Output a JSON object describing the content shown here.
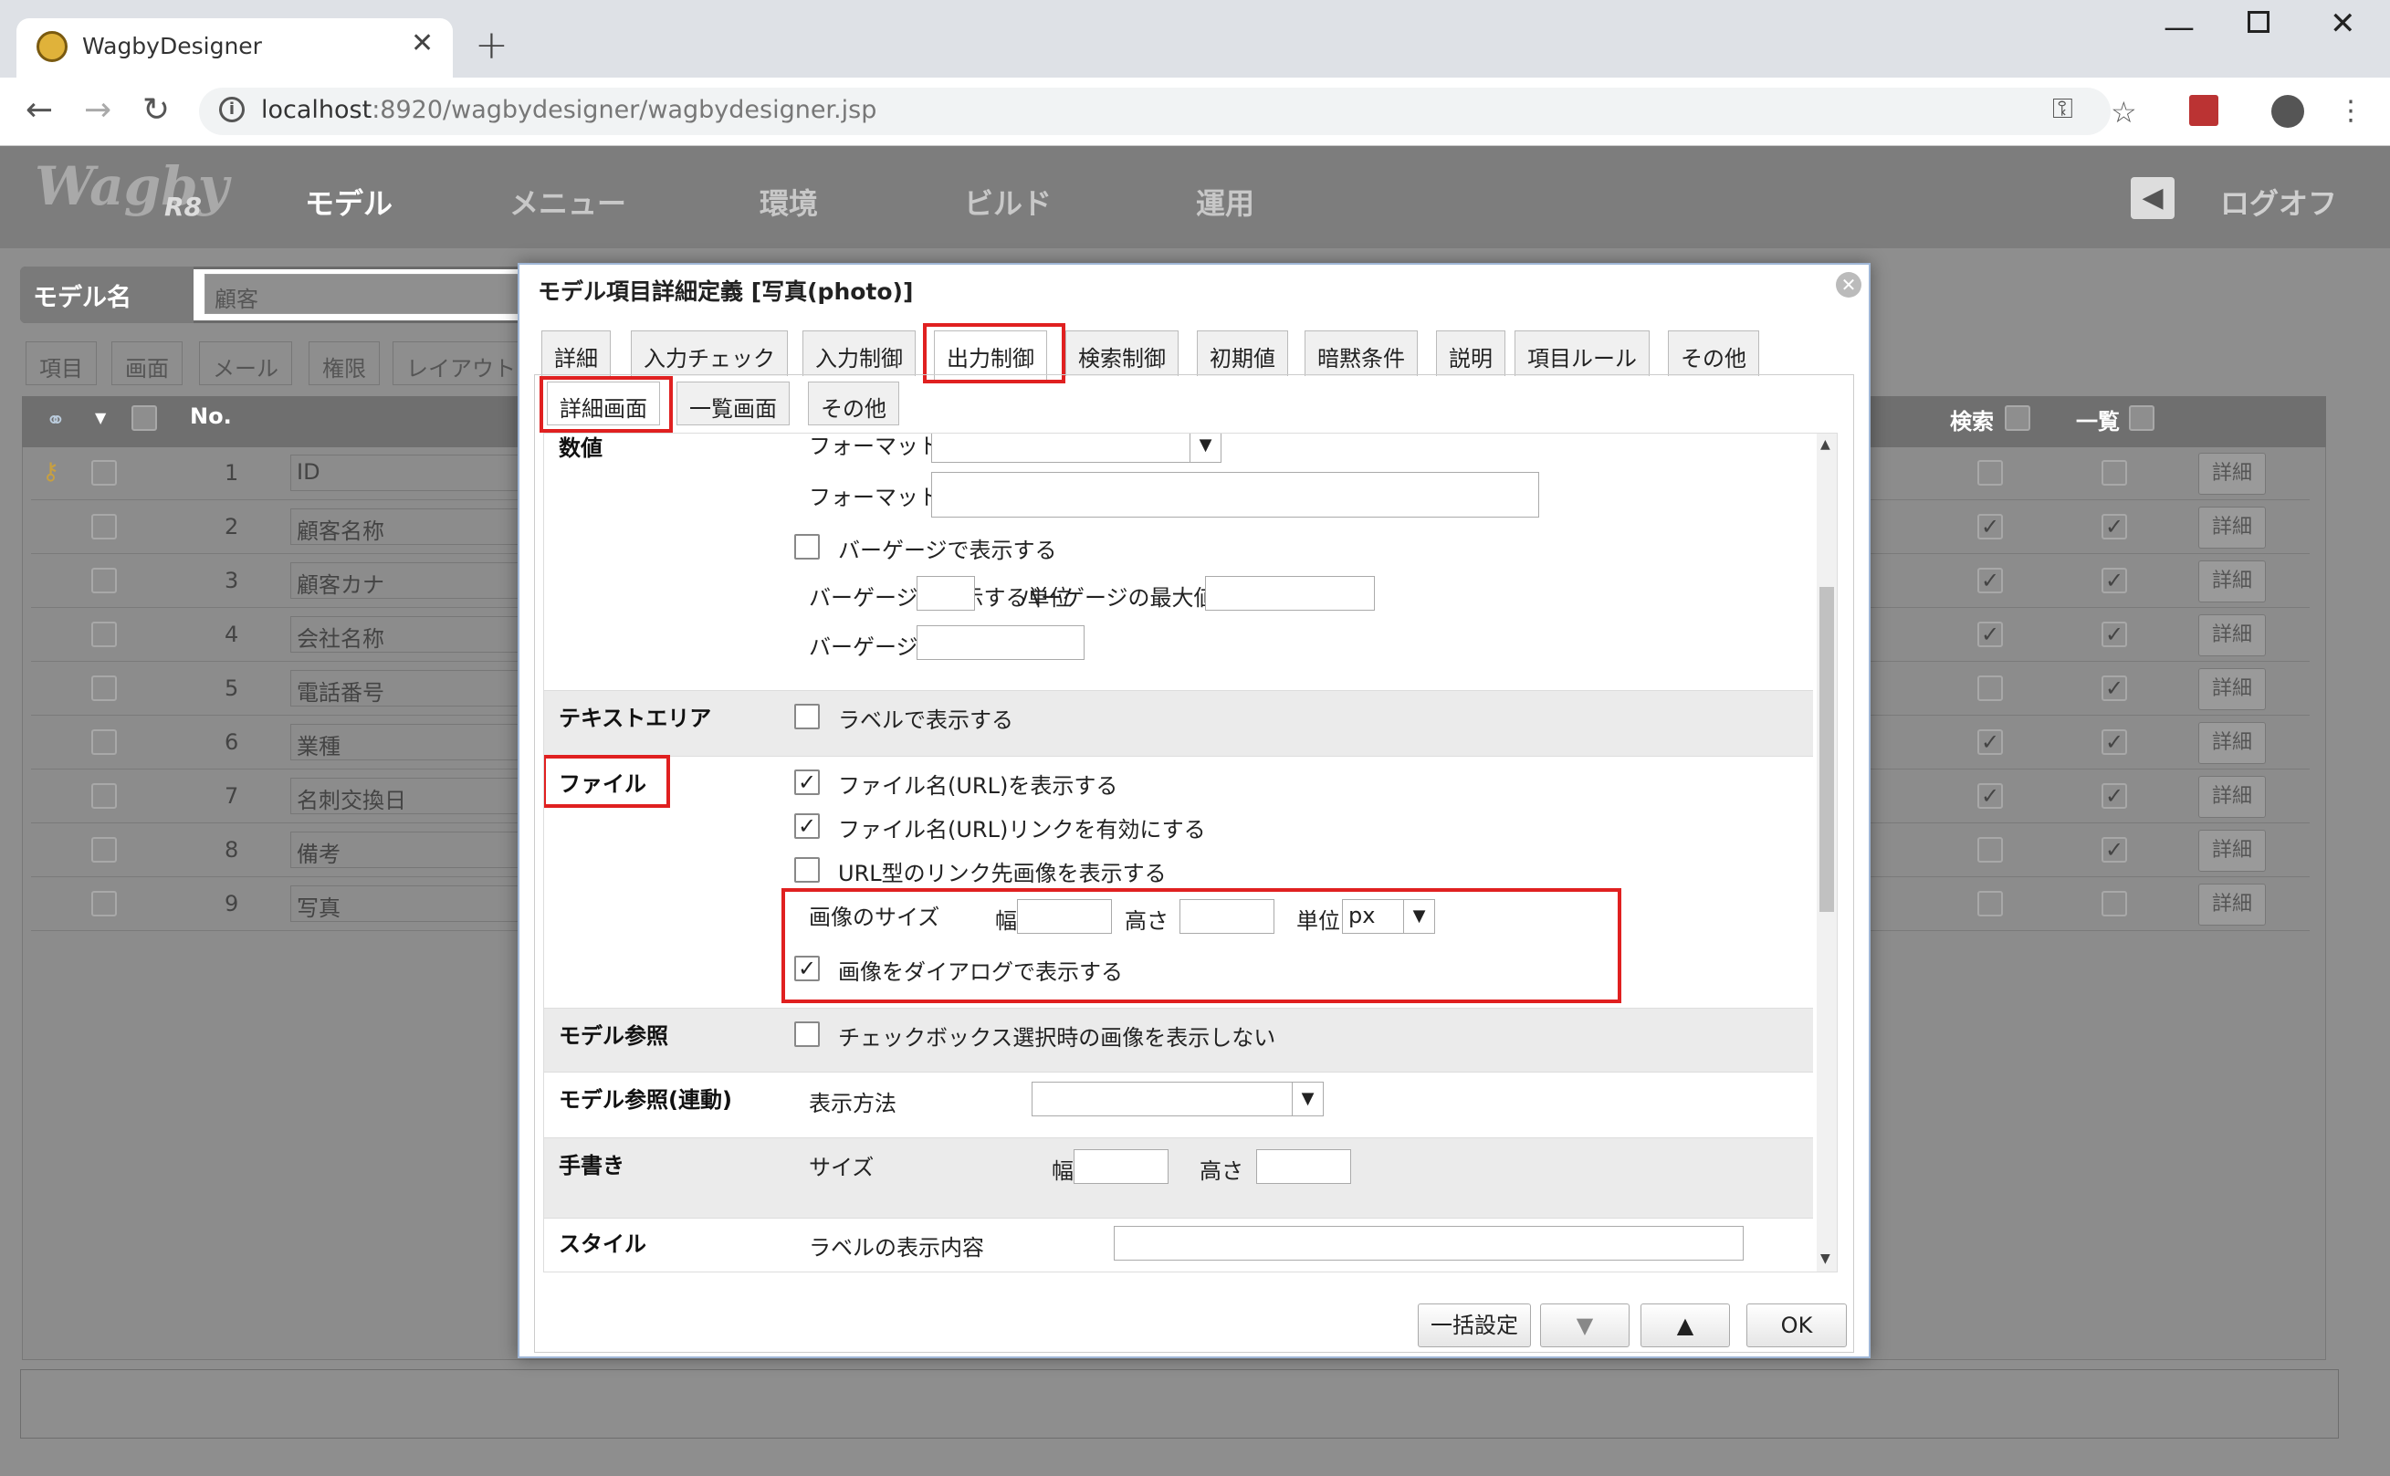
{
  "browser": {
    "tab_title": "WagbyDesigner",
    "url_host": "localhost",
    "url_rest": ":8920/wagbydesigner/wagbydesigner.jsp"
  },
  "app": {
    "logo_text": "Wagby",
    "logo_version": "R8",
    "nav": [
      "モデル",
      "メニュー",
      "環境",
      "ビルド",
      "運用"
    ],
    "logoff": "ログオフ",
    "model_name_label": "モデル名",
    "model_name_value": "顧客",
    "bg_tabs": [
      "項目",
      "画面",
      "メール",
      "権限",
      "レイアウト"
    ],
    "grid_headers": {
      "no": "No.",
      "search": "検索",
      "list": "一覧"
    },
    "rows": [
      {
        "no": "1",
        "name": "ID",
        "search": false,
        "list": false,
        "detail": "詳細"
      },
      {
        "no": "2",
        "name": "顧客名称",
        "search": true,
        "list": true,
        "detail": "詳細"
      },
      {
        "no": "3",
        "name": "顧客カナ",
        "search": true,
        "list": true,
        "detail": "詳細"
      },
      {
        "no": "4",
        "name": "会社名称",
        "search": true,
        "list": true,
        "detail": "詳細"
      },
      {
        "no": "5",
        "name": "電話番号",
        "search": false,
        "list": true,
        "detail": "詳細"
      },
      {
        "no": "6",
        "name": "業種",
        "search": true,
        "list": true,
        "detail": "詳細"
      },
      {
        "no": "7",
        "name": "名刺交換日",
        "search": true,
        "list": true,
        "detail": "詳細"
      },
      {
        "no": "8",
        "name": "備考",
        "search": false,
        "list": true,
        "detail": "詳細"
      },
      {
        "no": "9",
        "name": "写真",
        "search": false,
        "list": false,
        "detail": "詳細"
      }
    ]
  },
  "dialog": {
    "title": "モデル項目詳細定義 [写真(photo)]",
    "tabs": [
      "詳細",
      "入力チェック",
      "入力制御",
      "出力制御",
      "検索制御",
      "初期値",
      "暗黙条件",
      "説明",
      "項目ルール",
      "その他"
    ],
    "subtabs": [
      "詳細画面",
      "一覧画面",
      "その他"
    ],
    "sections": {
      "numeric": {
        "head": "数値",
        "format": "フォーマット",
        "format_user": "フォーマット(ユーザ定義)",
        "bargauge": "バーゲージで表示する",
        "bargauge_unit": "バーゲージに表示する単位",
        "bargauge_max": "バーゲージの最大値",
        "bargauge_color": "バーゲージの色"
      },
      "textarea": {
        "head": "テキストエリア",
        "label_display": "ラベルで表示する"
      },
      "file": {
        "head": "ファイル",
        "show_filename": "ファイル名(URL)を表示する",
        "link_filename": "ファイル名(URL)リンクを有効にする",
        "url_image": "URL型のリンク先画像を表示する",
        "image_size": "画像のサイズ",
        "width": "幅",
        "height": "高さ",
        "unit": "単位",
        "unit_value": "px",
        "dialog_image": "画像をダイアログで表示する"
      },
      "model_ref": {
        "head": "モデル参照",
        "no_image": "チェックボックス選択時の画像を表示しない"
      },
      "model_ref_linked": {
        "head": "モデル参照(連動)",
        "display_method": "表示方法"
      },
      "handwriting": {
        "head": "手書き",
        "size": "サイズ",
        "width": "幅",
        "height": "高さ"
      },
      "style": {
        "head": "スタイル",
        "label_content": "ラベルの表示内容"
      }
    },
    "buttons": {
      "bulk": "一括設定",
      "down": "▼",
      "up": "▲",
      "ok": "OK"
    }
  },
  "colors": {
    "highlight": "#e02020"
  }
}
